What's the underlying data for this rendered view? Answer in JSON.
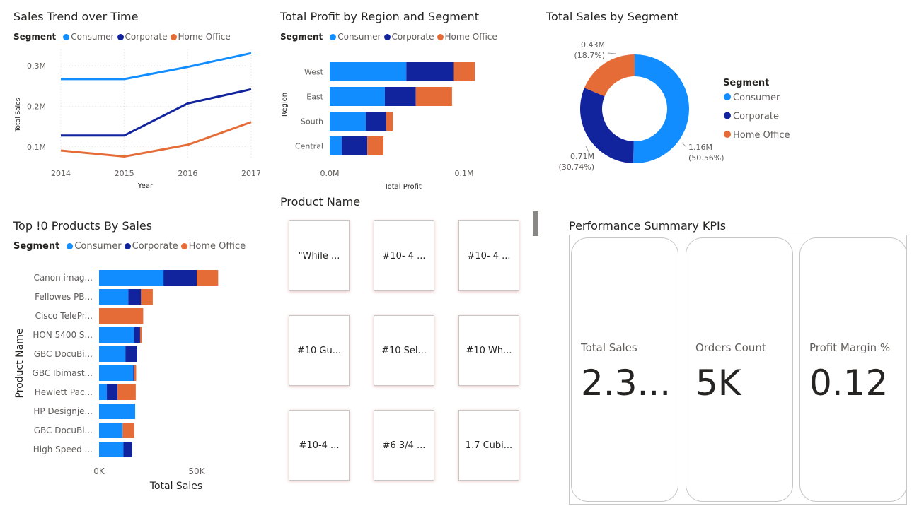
{
  "colors": {
    "consumer": "#118dff",
    "corporate": "#12239e",
    "home_office": "#e66c37"
  },
  "legend": {
    "label": "Segment",
    "items": [
      "Consumer",
      "Corporate",
      "Home Office"
    ]
  },
  "chart_data": [
    {
      "id": "sales_trend",
      "type": "line",
      "title": "Sales Trend over Time",
      "xlabel": "Year",
      "ylabel": "Total Sales",
      "x": [
        2014,
        2015,
        2016,
        2017
      ],
      "x_ticks": [
        "2014",
        "2015",
        "2016",
        "2017"
      ],
      "y_ticks": [
        "0.1M",
        "0.2M",
        "0.3M"
      ],
      "y_tick_values": [
        0.1,
        0.2,
        0.3
      ],
      "ylim": [
        0.07,
        0.34
      ],
      "series": [
        {
          "name": "Consumer",
          "values": [
            0.267,
            0.267,
            0.297,
            0.331
          ]
        },
        {
          "name": "Corporate",
          "values": [
            0.128,
            0.128,
            0.207,
            0.242
          ]
        },
        {
          "name": "Home Office",
          "values": [
            0.091,
            0.076,
            0.105,
            0.161
          ]
        }
      ]
    },
    {
      "id": "profit_region",
      "type": "bar",
      "orientation": "horizontal",
      "stacked": true,
      "title": "Total Profit by Region and Segment",
      "xlabel": "Total Profit",
      "ylabel": "Region",
      "categories": [
        "West",
        "East",
        "South",
        "Central"
      ],
      "x_ticks": [
        "0.0M",
        "0.1M"
      ],
      "x_tick_values": [
        0,
        0.1
      ],
      "xlim": [
        0,
        0.11
      ],
      "series": [
        {
          "name": "Consumer",
          "values": [
            0.057,
            0.041,
            0.027,
            0.009
          ]
        },
        {
          "name": "Corporate",
          "values": [
            0.035,
            0.023,
            0.015,
            0.019
          ]
        },
        {
          "name": "Home Office",
          "values": [
            0.016,
            0.027,
            0.005,
            0.012
          ]
        }
      ]
    },
    {
      "id": "sales_segment",
      "type": "pie",
      "donut": true,
      "title": "Total Sales by Segment",
      "categories": [
        "Consumer",
        "Corporate",
        "Home Office"
      ],
      "values": [
        1.16,
        0.71,
        0.43
      ],
      "value_labels": [
        "1.16M",
        "0.71M",
        "0.43M"
      ],
      "percent_labels": [
        "(50.56%)",
        "(30.74%)",
        "(18.7%)"
      ],
      "legend_title": "Segment",
      "legend_position": "right"
    },
    {
      "id": "top_products",
      "type": "bar",
      "orientation": "horizontal",
      "stacked": true,
      "title": "Top !0 Products By Sales",
      "xlabel": "Total Sales",
      "ylabel": "Product Name",
      "categories": [
        "Canon imag...",
        "Fellowes PB...",
        "Cisco TelePr...",
        "HON 5400 S...",
        "GBC DocuBi...",
        "GBC Ibimast...",
        "Hewlett Pac...",
        "HP Designje...",
        "GBC DocuBi...",
        "High Speed ..."
      ],
      "x_ticks": [
        "0K",
        "50K"
      ],
      "x_tick_values": [
        0,
        50
      ],
      "xlim": [
        0,
        62
      ],
      "series": [
        {
          "name": "Consumer",
          "values": [
            33,
            15,
            0,
            18,
            13.5,
            17.5,
            4,
            18.5,
            12,
            12.5
          ]
        },
        {
          "name": "Corporate",
          "values": [
            17,
            6.5,
            0,
            3,
            6,
            0.5,
            5.5,
            0,
            0,
            4.5
          ]
        },
        {
          "name": "Home Office",
          "values": [
            11,
            6,
            22.6,
            0.8,
            0,
            1,
            9.3,
            0,
            6,
            0
          ]
        }
      ]
    }
  ],
  "slicer": {
    "title": "Product Name",
    "tiles": [
      "\"While ...",
      "#10- 4 ...",
      "#10- 4 ...",
      "#10 Gu...",
      "#10 Sel...",
      "#10 Wh...",
      "#10-4 ...",
      "#6 3/4 ...",
      "1.7 Cubi..."
    ]
  },
  "kpis": {
    "title": "Performance Summary KPIs",
    "cards": [
      {
        "label": "Total Sales",
        "value": "2.3..."
      },
      {
        "label": "Orders Count",
        "value": "5K"
      },
      {
        "label": "Profit Margin %",
        "value": "0.12"
      }
    ]
  }
}
